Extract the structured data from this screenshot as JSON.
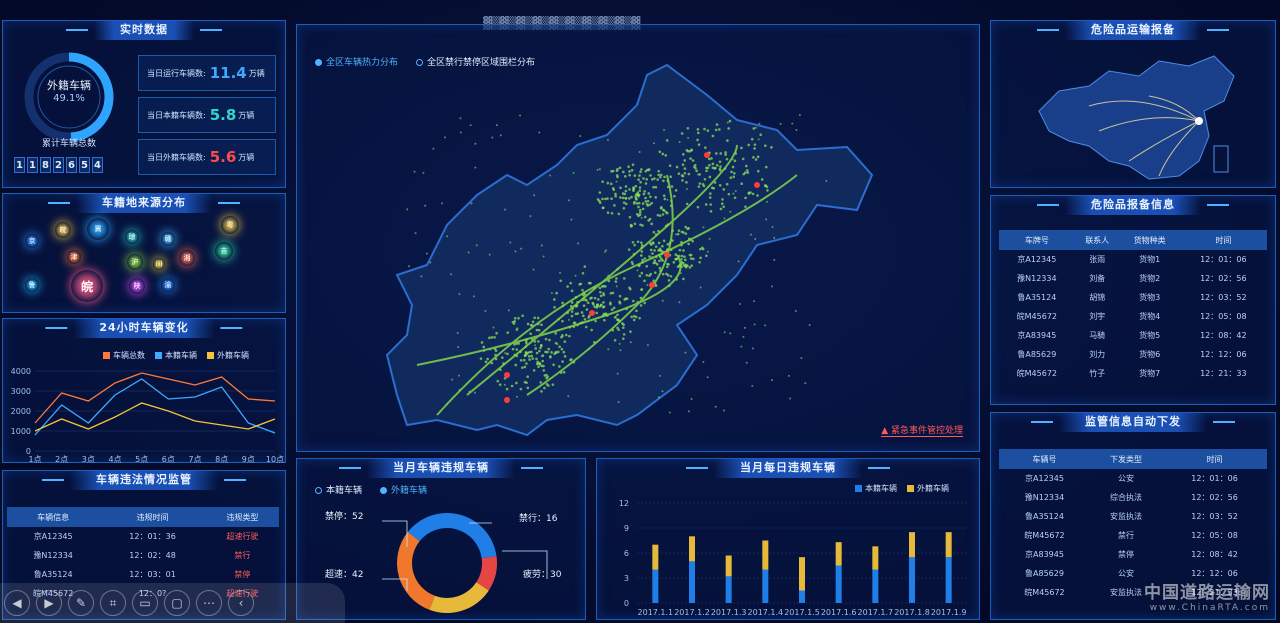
{
  "header": {
    "title": "▓▒▓▒▓▒▓▒▓▒▓▒▓▒▓▒▓▒▓"
  },
  "realtime": {
    "title": "实时数据",
    "ring_label": "外籍车辆",
    "ring_pct": "49.1%",
    "ring_value": 0.491,
    "total_label": "累计车辆总数",
    "total_digits": [
      "1",
      "1",
      "8",
      "2",
      "6",
      "5",
      "4"
    ],
    "stats": [
      {
        "label": "当日运行车辆数:",
        "value": "11.4",
        "unit": "万辆",
        "color": "#3fa9ff"
      },
      {
        "label": "当日本籍车辆数:",
        "value": "5.8",
        "unit": "万辆",
        "color": "#34d6c9"
      },
      {
        "label": "当日外籍车辆数:",
        "value": "5.6",
        "unit": "万辆",
        "color": "#ff4b4b"
      }
    ]
  },
  "origin": {
    "title": "车籍地来源分布",
    "balls": [
      {
        "t": "京",
        "c": "#2a8cff"
      },
      {
        "t": "皖",
        "c": "#f5c33b"
      },
      {
        "t": "冀",
        "c": "#2aa8ff"
      },
      {
        "t": "琼",
        "c": "#2bd0c8"
      },
      {
        "t": "赣",
        "c": "#3fb8ff"
      },
      {
        "t": "粤",
        "c": "#e8c23d"
      },
      {
        "t": "津",
        "c": "#ff7a3a"
      },
      {
        "t": "沪",
        "c": "#8bd63f"
      },
      {
        "t": "川",
        "c": "#f5d63b"
      },
      {
        "t": "湘",
        "c": "#ff6b4a"
      },
      {
        "t": "吉",
        "c": "#2fd6a0"
      },
      {
        "t": "鲁",
        "c": "#1fb6ff"
      },
      {
        "t": "皖",
        "c": "#ff5a8a"
      },
      {
        "t": "陕",
        "c": "#d94fff"
      },
      {
        "t": "渝",
        "c": "#2a8cff"
      }
    ]
  },
  "hourly": {
    "title": "24小时车辆变化",
    "legend": [
      {
        "name": "车辆总数",
        "color": "#ff7a3a"
      },
      {
        "name": "本籍车辆",
        "color": "#3fa9ff"
      },
      {
        "name": "外籍车辆",
        "color": "#f5c33b"
      }
    ]
  },
  "violation_monitor": {
    "title": "车辆违法情况监管",
    "headers": [
      "车辆信息",
      "违规时间",
      "违规类型"
    ],
    "rows": [
      [
        "京A12345",
        "12：01：36",
        "超速行驶"
      ],
      [
        "豫N12334",
        "12：02：48",
        "禁行"
      ],
      [
        "鲁A35124",
        "12：03：01",
        "禁停"
      ],
      [
        "皖M45672",
        "12：0?",
        "超速行驶"
      ]
    ]
  },
  "map": {
    "tabs": [
      {
        "label": "全区车辆热力分布",
        "active": true
      },
      {
        "label": "全区禁行禁停区域围栏分布",
        "active": false
      }
    ],
    "emergency": "紧急事件管控处理"
  },
  "month_violation": {
    "title": "当月车辆违规车辆",
    "tabs": [
      {
        "label": "本籍车辆",
        "active": false
      },
      {
        "label": "外籍车辆",
        "active": true
      }
    ],
    "labels": [
      {
        "text": "禁停：52"
      },
      {
        "text": "禁行：16"
      },
      {
        "text": "超速：42"
      },
      {
        "text": "疲劳：30"
      }
    ]
  },
  "daily_violation": {
    "title": "当月每日违规车辆",
    "legend": [
      {
        "name": "本籍车辆",
        "color": "#1f7fe6"
      },
      {
        "name": "外籍车辆",
        "color": "#e6b93a"
      }
    ]
  },
  "hazard_report": {
    "title": "危险品运输报备"
  },
  "hazard_info": {
    "title": "危险品报备信息",
    "headers": [
      "车牌号",
      "联系人",
      "货物种类",
      "时间"
    ],
    "rows": [
      [
        "京A12345",
        "张雨",
        "货物1",
        "12：01：06"
      ],
      [
        "豫N12334",
        "刘备",
        "货物2",
        "12：02：56"
      ],
      [
        "鲁A35124",
        "胡锦",
        "货物3",
        "12：03：52"
      ],
      [
        "皖M45672",
        "刘宇",
        "货物4",
        "12：05：08"
      ],
      [
        "京A83945",
        "马騎",
        "货物5",
        "12：08：42"
      ],
      [
        "鲁A85629",
        "刘力",
        "货物6",
        "12：12：06"
      ],
      [
        "皖M45672",
        "竹子",
        "货物7",
        "12：21：33"
      ]
    ]
  },
  "supervision": {
    "title": "监管信息自动下发",
    "headers": [
      "车辆号",
      "下发类型",
      "时间"
    ],
    "rows": [
      [
        "京A12345",
        "公安",
        "12：01：06"
      ],
      [
        "豫N12334",
        "综合执法",
        "12：02：56"
      ],
      [
        "鲁A35124",
        "安监执法",
        "12：03：52"
      ],
      [
        "皖M45672",
        "禁行",
        "12：05：08"
      ],
      [
        "京A83945",
        "禁停",
        "12：08：42"
      ],
      [
        "鲁A85629",
        "公安",
        "12：12：06"
      ],
      [
        "皖M45672",
        "安监执法",
        "12：21：33"
      ]
    ]
  },
  "watermark": {
    "cn": "中国道路运输网",
    "url": "www.ChinaRTA.com"
  },
  "chart_data": [
    {
      "type": "line",
      "title": "24小时车辆变化",
      "categories": [
        "1点",
        "2点",
        "3点",
        "4点",
        "5点",
        "6点",
        "7点",
        "8点",
        "9点",
        "10点"
      ],
      "ylim": [
        0,
        4000
      ],
      "yticks": [
        0,
        1000,
        2000,
        3000,
        4000
      ],
      "series": [
        {
          "name": "车辆总数",
          "color": "#ff7a3a",
          "values": [
            1400,
            2900,
            2500,
            3400,
            3900,
            3600,
            3300,
            3700,
            2600,
            2500
          ]
        },
        {
          "name": "本籍车辆",
          "color": "#3fa9ff",
          "values": [
            800,
            2300,
            1400,
            2800,
            3600,
            2600,
            2700,
            3200,
            1400,
            900
          ]
        },
        {
          "name": "外籍车辆",
          "color": "#f5c33b",
          "values": [
            1000,
            1600,
            1100,
            1700,
            2400,
            2000,
            1500,
            1300,
            1100,
            1600
          ]
        }
      ]
    },
    {
      "type": "pie",
      "title": "当月车辆违规车辆",
      "slices": [
        {
          "name": "禁停",
          "value": 52,
          "color": "#1f7fe6"
        },
        {
          "name": "禁行",
          "value": 16,
          "color": "#e64545"
        },
        {
          "name": "疲劳",
          "value": 30,
          "color": "#e6b93a"
        },
        {
          "name": "超速",
          "value": 42,
          "color": "#f0782c"
        }
      ]
    },
    {
      "type": "bar",
      "title": "当月每日违规车辆",
      "categories": [
        "2017.1.1",
        "2017.1.2",
        "2017.1.3",
        "2017.1.4",
        "2017.1.5",
        "2017.1.6",
        "2017.1.7",
        "2017.1.8",
        "2017.1.9"
      ],
      "ylim": [
        0,
        12
      ],
      "yticks": [
        0,
        3,
        6,
        9,
        12
      ],
      "series": [
        {
          "name": "本籍车辆",
          "color": "#1f7fe6",
          "values": [
            4,
            5,
            3.2,
            4,
            1.5,
            4.5,
            4,
            5.5,
            5.5
          ]
        },
        {
          "name": "外籍车辆",
          "color": "#e6b93a",
          "values": [
            3,
            3,
            2.5,
            3.5,
            4,
            2.8,
            2.8,
            3,
            3
          ]
        }
      ]
    }
  ]
}
